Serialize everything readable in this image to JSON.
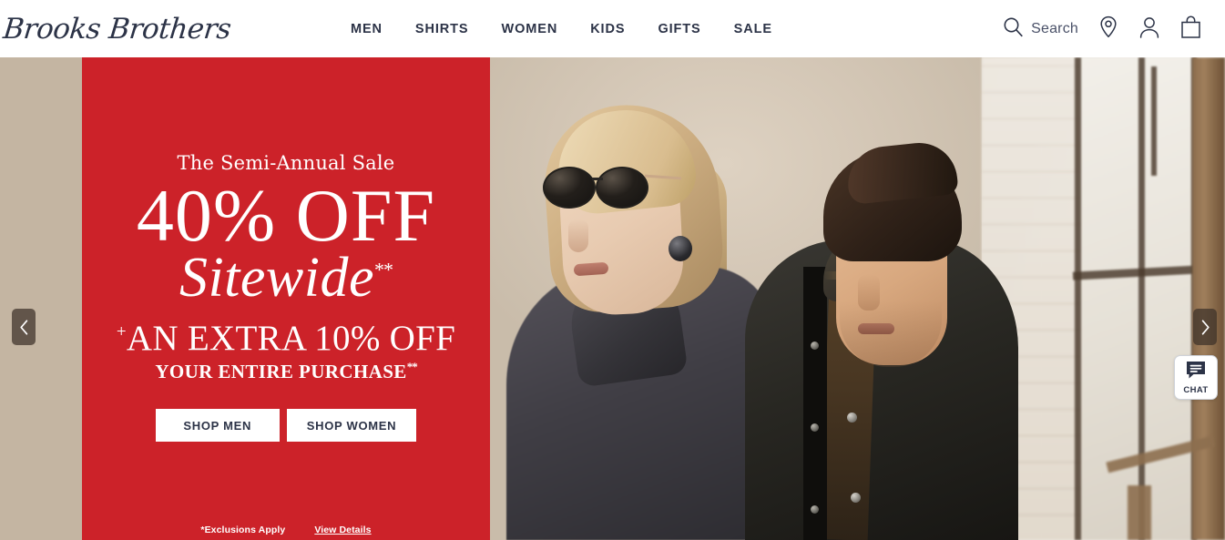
{
  "header": {
    "logo_text": "Brooks Brothers",
    "logo_icon": "brooks-brothers-wordmark",
    "nav": [
      {
        "label": "MEN"
      },
      {
        "label": "SHIRTS"
      },
      {
        "label": "WOMEN"
      },
      {
        "label": "KIDS"
      },
      {
        "label": "GIFTS"
      },
      {
        "label": "SALE"
      }
    ],
    "tools": {
      "search_label": "Search",
      "search_icon": "search-icon",
      "store_locator_icon": "location-pin-icon",
      "account_icon": "user-account-icon",
      "bag_icon": "shopping-bag-icon"
    }
  },
  "hero": {
    "promo": {
      "eyebrow": "The Semi-Annual Sale",
      "headline": "40% OFF",
      "subheadline": "Sitewide",
      "subheadline_superscript": "**",
      "extra_plus": "+",
      "extra_line": "AN EXTRA 10% OFF",
      "purchase_line": "YOUR ENTIRE PURCHASE",
      "purchase_superscript": "**",
      "buttons": [
        {
          "label": "SHOP MEN"
        },
        {
          "label": "SHOP WOMEN"
        }
      ],
      "exclusions_note": "*Exclusions Apply",
      "details_link": "View Details",
      "background_color": "#cc2229",
      "text_color": "#ffffff"
    },
    "carousel": {
      "prev_icon": "chevron-left-icon",
      "next_icon": "chevron-right-icon"
    },
    "image_alt": "Two models in dark outerwear standing in a loft with industrial windows"
  },
  "chat": {
    "label": "CHAT",
    "icon": "chat-bubble-icon"
  },
  "colors": {
    "brand_navy": "#2c3347",
    "promo_red": "#cc2229",
    "beige_band": "#c4b5a2",
    "white": "#ffffff"
  }
}
